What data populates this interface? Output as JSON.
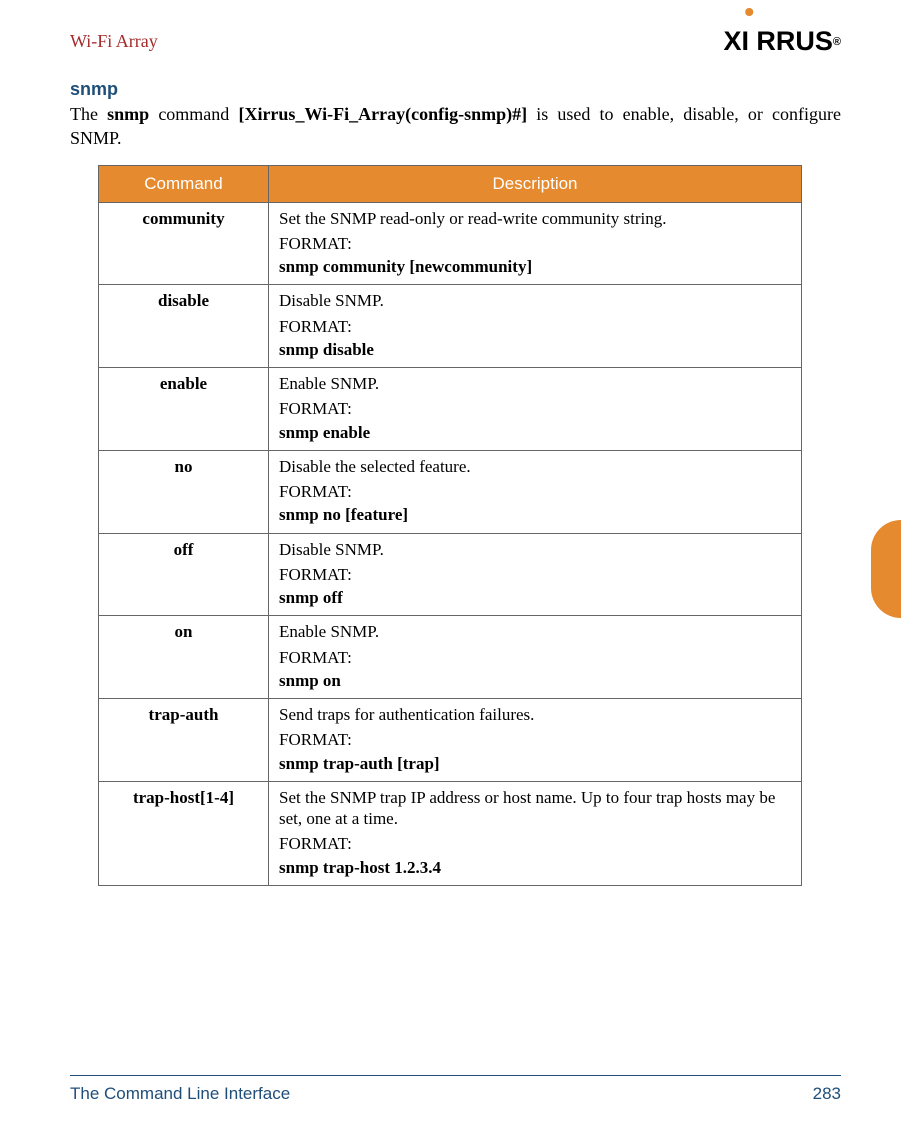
{
  "header": {
    "left": "Wi-Fi Array",
    "logo_text_1": "X",
    "logo_text_2": "RRUS",
    "logo_reg": "®"
  },
  "section": {
    "heading": "snmp",
    "intro_pre": "The ",
    "intro_bold1": "snmp",
    "intro_mid": " command ",
    "intro_bold2": "[Xirrus_Wi-Fi_Array(config-snmp)#]",
    "intro_post": " is used to enable, disable, or configure SNMP."
  },
  "table": {
    "col_command": "Command",
    "col_description": "Description",
    "rows": [
      {
        "cmd": "community",
        "desc": "Set the SNMP read-only or read-write community string.",
        "fmt_label": "FORMAT:",
        "fmt_cmd": "snmp community [newcommunity]"
      },
      {
        "cmd": "disable",
        "desc": "Disable SNMP.",
        "fmt_label": "FORMAT:",
        "fmt_cmd": "snmp disable"
      },
      {
        "cmd": "enable",
        "desc": "Enable SNMP.",
        "fmt_label": "FORMAT:",
        "fmt_cmd": "snmp enable"
      },
      {
        "cmd": "no",
        "desc": "Disable the selected feature.",
        "fmt_label": "FORMAT:",
        "fmt_cmd": "snmp no [feature]"
      },
      {
        "cmd": "off",
        "desc": "Disable SNMP.",
        "fmt_label": "FORMAT:",
        "fmt_cmd": "snmp off"
      },
      {
        "cmd": "on",
        "desc": "Enable SNMP.",
        "fmt_label": "FORMAT:",
        "fmt_cmd": "snmp on"
      },
      {
        "cmd": "trap-auth",
        "desc": "Send traps for authentication failures.",
        "fmt_label": "FORMAT:",
        "fmt_cmd": "snmp trap-auth [trap]"
      },
      {
        "cmd": "trap-host[1-4]",
        "desc": "Set the SNMP trap IP address or host name. Up to four trap hosts may be set, one at a time.",
        "fmt_label": "FORMAT:",
        "fmt_cmd": "snmp trap-host 1.2.3.4"
      }
    ]
  },
  "footer": {
    "left": "The Command Line Interface",
    "right": "283"
  }
}
